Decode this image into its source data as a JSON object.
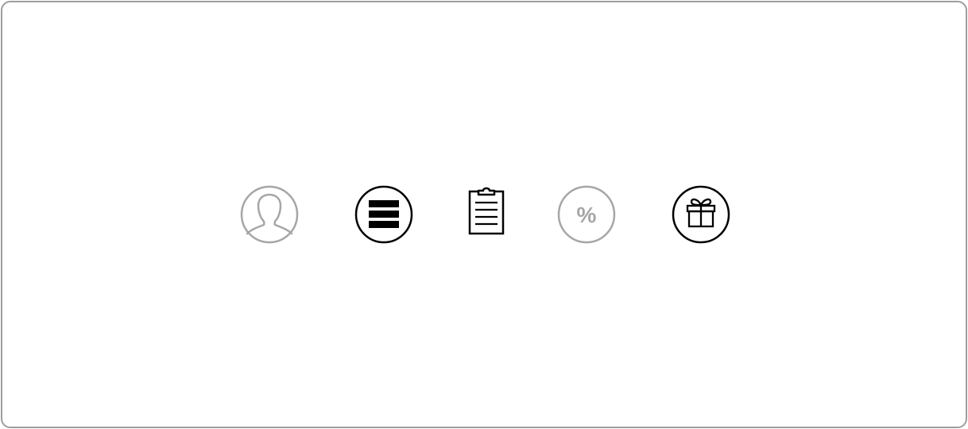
{
  "toolbar": {
    "items": [
      {
        "icon": "user-silhouette-icon",
        "state": "inactive"
      },
      {
        "icon": "menu-list-icon",
        "state": "active"
      },
      {
        "icon": "clipboard-icon",
        "state": "active"
      },
      {
        "icon": "percent-icon",
        "state": "inactive",
        "label": "%"
      },
      {
        "icon": "gift-icon",
        "state": "active"
      }
    ]
  },
  "colors": {
    "active": "#000000",
    "inactive": "#a6a6a6",
    "frame_border": "#9e9e9e",
    "background": "#ffffff"
  }
}
